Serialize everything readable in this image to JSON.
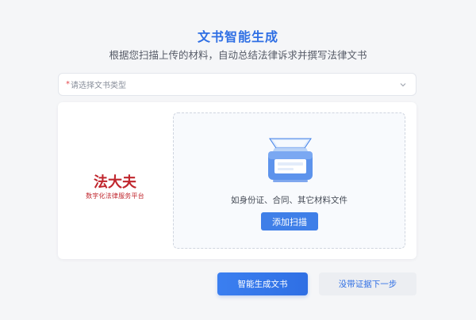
{
  "header": {
    "title": "文书智能生成",
    "subtitle": "根据您扫描上传的材料，自动总结法律诉求并撰写法律文书"
  },
  "doc_type_select": {
    "required_mark": "*",
    "placeholder": "请选择文书类型",
    "icon": "chevron-down-icon"
  },
  "logo": {
    "brand": "法大夫",
    "tagline": "数字化法律服务平台",
    "color": "#c0262d"
  },
  "upload": {
    "icon": "scanner-icon",
    "hint": "如身份证、合同、其它材料文件",
    "scan_button": "添加扫描"
  },
  "actions": {
    "generate_label": "智能生成文书",
    "next_label": "没带证据下一步"
  },
  "colors": {
    "accent": "#2f6fe4",
    "required": "#e5484d",
    "background": "#f5f6f8"
  }
}
